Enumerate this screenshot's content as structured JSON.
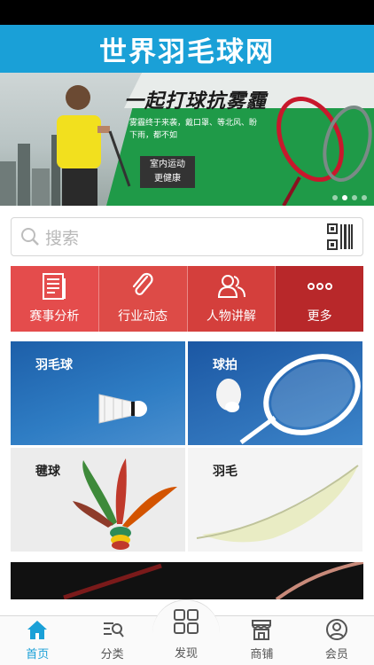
{
  "app": {
    "title": "世界羽毛球网"
  },
  "banner": {
    "headline": "一起打球抗雾霾",
    "subtext": "雾霾终于来袭，戴口罩、等北风、盼下雨，都不如",
    "promo_line1": "室内运动",
    "promo_line2": "更健康",
    "slides": 4,
    "active_slide": 2
  },
  "search": {
    "placeholder": "搜索",
    "search_icon": "search-icon",
    "scan_icon": "qr-code-icon"
  },
  "categories": [
    {
      "label": "赛事分析",
      "icon": "newspaper-icon",
      "color": "#e44c4c"
    },
    {
      "label": "行业动态",
      "icon": "paperclip-icon",
      "color": "#dd4b47"
    },
    {
      "label": "人物讲解",
      "icon": "people-icon",
      "color": "#d43f3c"
    },
    {
      "label": "更多",
      "icon": "more-dots-icon",
      "color": "#b8282a"
    }
  ],
  "tiles": [
    {
      "label": "羽毛球"
    },
    {
      "label": "球拍"
    },
    {
      "label": "毽球"
    },
    {
      "label": "羽毛"
    }
  ],
  "tabbar": {
    "items": [
      {
        "label": "首页",
        "icon": "home-icon",
        "active": true
      },
      {
        "label": "分类",
        "icon": "category-search-icon",
        "active": false
      },
      {
        "label": "发现",
        "icon": "grid-icon",
        "active": false
      },
      {
        "label": "商铺",
        "icon": "shop-icon",
        "active": false
      },
      {
        "label": "会员",
        "icon": "user-icon",
        "active": false
      }
    ]
  },
  "colors": {
    "accent": "#1aa0d7",
    "banner_green": "#1f9a48"
  }
}
